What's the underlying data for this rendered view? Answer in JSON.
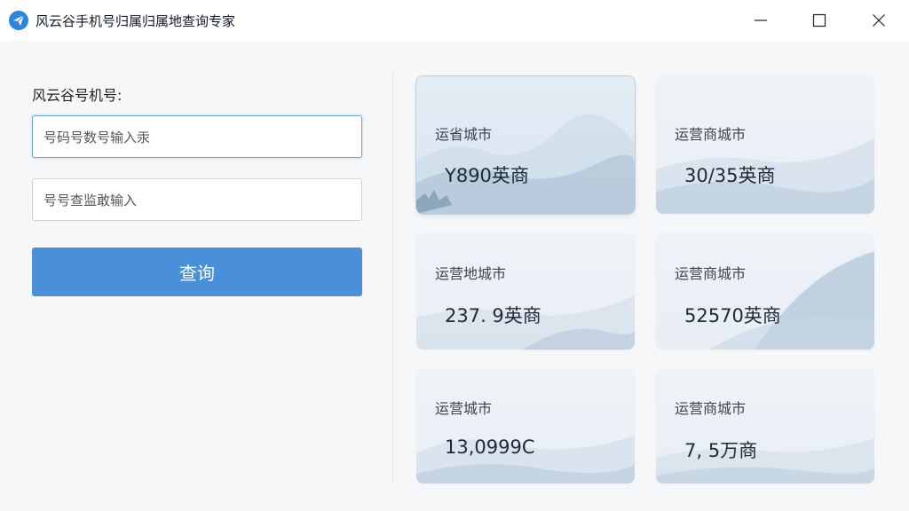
{
  "app": {
    "title": "风云谷手机号归属归属地查询专家"
  },
  "form": {
    "section_label": "风云谷号机号:",
    "phone_input_value": "号码号数号输入汞",
    "query_input_value": "号号查监敢输入",
    "query_button_label": "查询"
  },
  "cards": [
    {
      "title": "运省城市",
      "value": "Y890英商"
    },
    {
      "title": "运营商城市",
      "value": "30/35英商"
    },
    {
      "title": "运营地城市",
      "value": "237. 9英商"
    },
    {
      "title": "运营商城市",
      "value": "52570英商"
    },
    {
      "title": "运营城市",
      "value": "13,0999C"
    },
    {
      "title": "运营商城市",
      "value": "7, 5万商"
    }
  ],
  "colors": {
    "accent": "#4a90d9",
    "titlebar": "#ffffff",
    "background": "#f6f7f8",
    "card": "#e9f0f6"
  },
  "icons": {
    "app": "paper-plane-icon",
    "minimize": "minimize-icon",
    "maximize": "maximize-icon",
    "close": "close-icon"
  }
}
